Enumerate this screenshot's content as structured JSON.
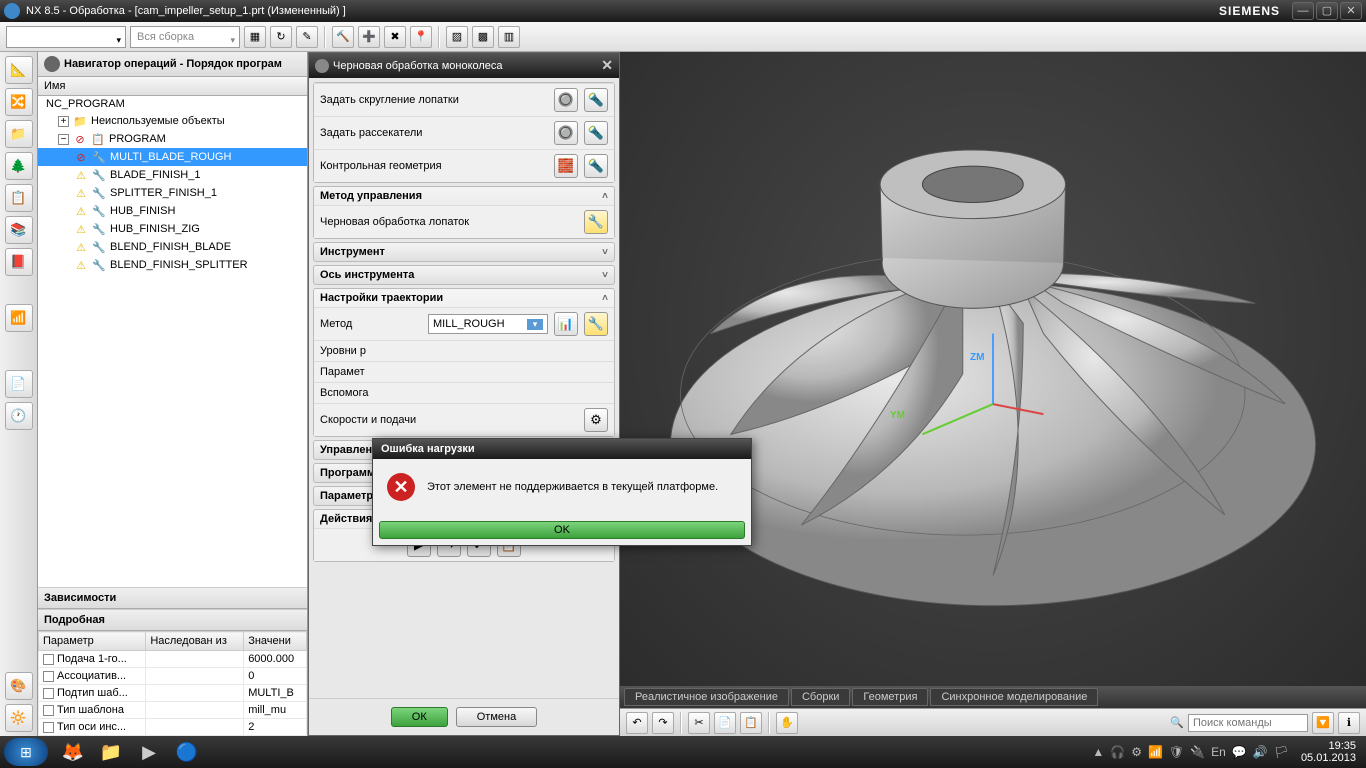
{
  "window": {
    "title": "NX 8.5 - Обработка - [cam_impeller_setup_1.prt (Измененный) ]",
    "brand": "SIEMENS"
  },
  "top_toolbar": {
    "assembly_scope": "Вся сборка"
  },
  "navigator": {
    "title": "Навигатор операций - Порядок програм",
    "col_header": "Имя",
    "root": "NC_PROGRAM",
    "unused": "Неиспользуемые объекты",
    "program": "PROGRAM",
    "ops": [
      "MULTI_BLADE_ROUGH",
      "BLADE_FINISH_1",
      "SPLITTER_FINISH_1",
      "HUB_FINISH",
      "HUB_FINISH_ZIG",
      "BLEND_FINISH_BLADE",
      "BLEND_FINISH_SPLITTER"
    ],
    "dependencies": "Зависимости",
    "details": "Подробная"
  },
  "param_table": {
    "headers": {
      "param": "Параметр",
      "inherited": "Наследован из",
      "value": "Значени"
    },
    "rows": [
      {
        "param": "Подача 1-го...",
        "inherited": "",
        "value": "6000.000"
      },
      {
        "param": "Ассоциатив...",
        "inherited": "",
        "value": "0"
      },
      {
        "param": "Подтип шаб...",
        "inherited": "",
        "value": "MULTI_B"
      },
      {
        "param": "Тип шаблона",
        "inherited": "",
        "value": "mill_mu"
      },
      {
        "param": "Тип оси инс...",
        "inherited": "",
        "value": "2"
      }
    ]
  },
  "dialog": {
    "title": "Черновая обработка моноколеса",
    "rows": {
      "blade_fillet": "Задать скругление лопатки",
      "splitters": "Задать рассекатели",
      "check_geom": "Контрольная геометрия"
    },
    "sections": {
      "drive_method": "Метод управления",
      "blade_rough": "Черновая обработка лопаток",
      "tool": "Инструмент",
      "tool_axis": "Ось инструмента",
      "path_settings": "Настройки траектории",
      "method_label": "Метод",
      "method_value": "MILL_ROUGH",
      "levels": "Уровни р",
      "params": "Парамет",
      "aux": "Вспомога",
      "speeds": "Скорости и подачи",
      "machine_ctrl": "Управление станком",
      "program": "Программа",
      "parameters": "Параметры",
      "actions": "Действия"
    },
    "footer": {
      "ok": "ОК",
      "cancel": "Отмена"
    }
  },
  "error_modal": {
    "title": "Ошибка нагрузки",
    "message": "Этот элемент не поддерживается в текущей платформе.",
    "ok": "OK"
  },
  "viewport": {
    "tabs": [
      "Реалистичное изображение",
      "Сборки",
      "Геометрия",
      "Синхронное моделирование"
    ],
    "search_placeholder": "Поиск команды",
    "axis": {
      "zm": "ZM",
      "ym": "YM"
    }
  },
  "taskbar": {
    "time": "19:35",
    "date": "05.01.2013",
    "lang": "En"
  }
}
